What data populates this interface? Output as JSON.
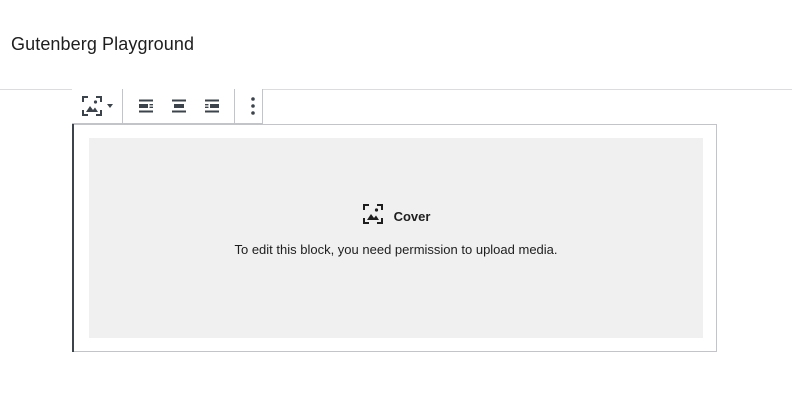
{
  "header": {
    "title": "Gutenberg Playground"
  },
  "toolbar": {
    "block_type_icon": "cover-image-icon",
    "dropdown_icon": "caret-down-icon",
    "align_items": [
      {
        "icon": "align-left-icon"
      },
      {
        "icon": "align-center-icon"
      },
      {
        "icon": "align-right-icon"
      }
    ],
    "more_icon": "more-vertical-icon"
  },
  "block": {
    "label": "Cover",
    "icon": "cover-image-icon",
    "instructions": "To edit this block, you need permission to upload media."
  }
}
